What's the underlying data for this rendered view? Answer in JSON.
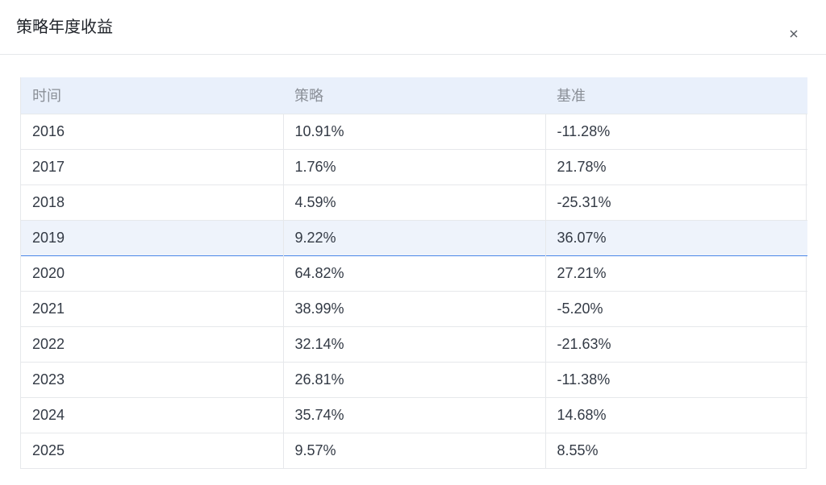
{
  "dialog": {
    "title": "策略年度收益",
    "close_icon": "close-icon"
  },
  "table": {
    "columns": [
      "时间",
      "策略",
      "基准"
    ],
    "rows": [
      [
        "2016",
        "10.91%",
        "-11.28%"
      ],
      [
        "2017",
        "1.76%",
        "21.78%"
      ],
      [
        "2018",
        "4.59%",
        "-25.31%"
      ],
      [
        "2019",
        "9.22%",
        "36.07%"
      ],
      [
        "2020",
        "64.82%",
        "27.21%"
      ],
      [
        "2021",
        "38.99%",
        "-5.20%"
      ],
      [
        "2022",
        "32.14%",
        "-21.63%"
      ],
      [
        "2023",
        "26.81%",
        "-11.38%"
      ],
      [
        "2024",
        "35.74%",
        "14.68%"
      ],
      [
        "2025",
        "9.57%",
        "8.55%"
      ]
    ],
    "highlighted_row": 3
  },
  "colors": {
    "header_bg": "#e9f0fb",
    "hover_row_bg": "#eef3fb",
    "hover_border": "#4a86e8",
    "border": "#e6e8eb"
  }
}
